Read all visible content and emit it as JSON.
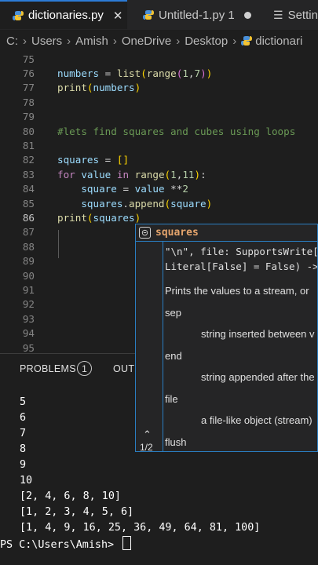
{
  "tabs": [
    {
      "label": "dictionaries.py",
      "close": "✕"
    },
    {
      "label": "Untitled-1.py 1"
    },
    {
      "label": "Settin"
    }
  ],
  "breadcrumb": [
    "C:",
    "Users",
    "Amish",
    "OneDrive",
    "Desktop",
    "dictionari"
  ],
  "editor": {
    "lines": [
      {
        "n": "75",
        "code": ""
      },
      {
        "n": "76",
        "code": "numbers = list(range(1,7))"
      },
      {
        "n": "77",
        "code": "print(numbers)"
      },
      {
        "n": "78",
        "code": ""
      },
      {
        "n": "79",
        "code": ""
      },
      {
        "n": "80",
        "code": "#lets find squares and cubes using loops"
      },
      {
        "n": "81",
        "code": ""
      },
      {
        "n": "82",
        "code": "squares = []"
      },
      {
        "n": "83",
        "code": "for value in range(1,11):"
      },
      {
        "n": "84",
        "code": "    square = value **2"
      },
      {
        "n": "85",
        "code": "    squares.append(square)"
      },
      {
        "n": "86",
        "code": "print(squares)"
      },
      {
        "n": "87",
        "code": ""
      },
      {
        "n": "88",
        "code": ""
      },
      {
        "n": "89",
        "code": ""
      },
      {
        "n": "90",
        "code": ""
      },
      {
        "n": "91",
        "code": ""
      },
      {
        "n": "92",
        "code": ""
      },
      {
        "n": "93",
        "code": ""
      },
      {
        "n": "94",
        "code": ""
      },
      {
        "n": "95",
        "code": ""
      }
    ]
  },
  "panel": {
    "tabs": [
      "PROBLEMS",
      "OUTP"
    ],
    "problems_count": "1"
  },
  "terminal": {
    "lines": [
      "5",
      "6",
      "7",
      "8",
      "9",
      "10",
      "[2, 4, 6, 8, 10]",
      "[1, 2, 3, 4, 5, 6]",
      "[1, 4, 9, 16, 25, 36, 49, 64, 81, 100]"
    ],
    "prompt": "PS C:\\Users\\Amish> "
  },
  "hover": {
    "title": "squares",
    "sig1": "\"\\n\", file: SupportsWrite[",
    "sig2": "Literal[False] = False) ->",
    "desc": "Prints the values to a stream, or",
    "sep": "sep",
    "sep_desc": "string inserted between v",
    "end": "end",
    "end_desc": "string appended after the",
    "file": "file",
    "file_desc": "a file-like object (stream)",
    "flush": "flush",
    "nav_count": "1/2"
  },
  "colors": {
    "accent": "#2a7ec2",
    "keyword": "#c586c0",
    "function": "#dcdcaa",
    "variable": "#9cdcfe",
    "number": "#b5cea8",
    "comment": "#6a9955"
  }
}
